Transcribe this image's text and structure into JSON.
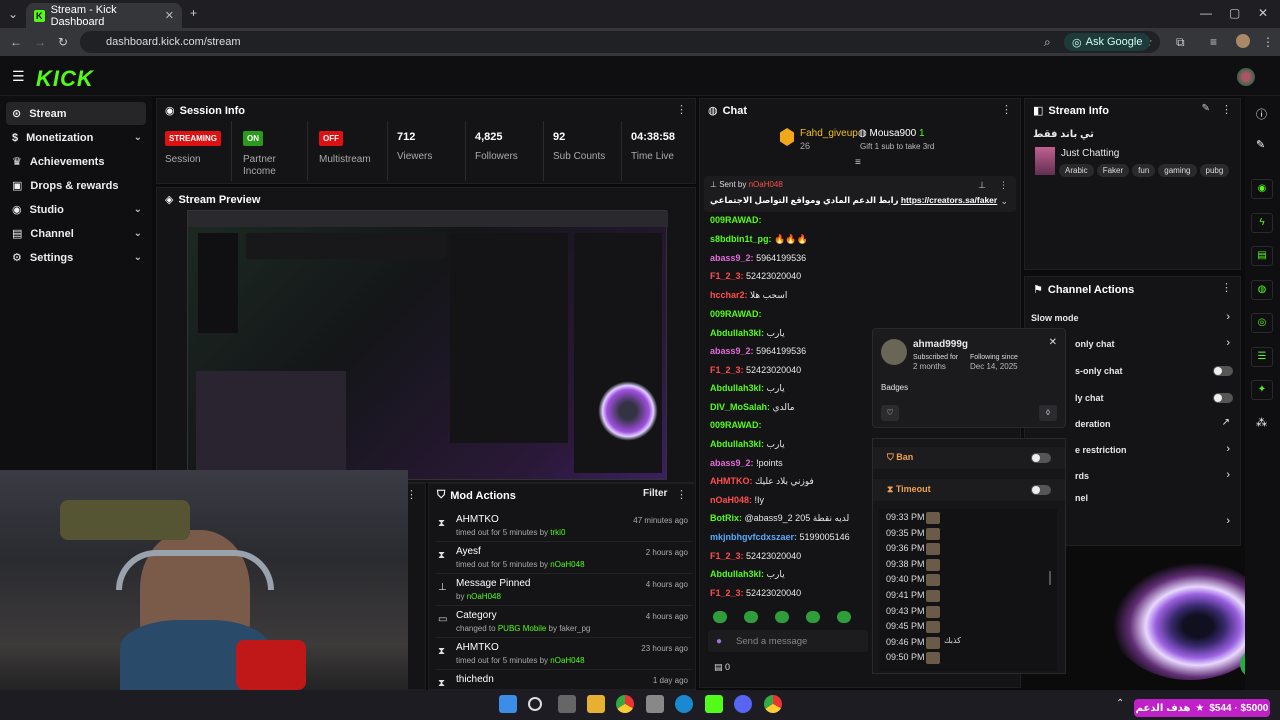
{
  "browser": {
    "tab_title": "Stream - Kick Dashboard",
    "url": "dashboard.kick.com/stream",
    "ask_google": "Ask Google"
  },
  "app": {
    "logo": "KICK"
  },
  "sidebar": {
    "items": [
      {
        "label": "Stream",
        "active": true
      },
      {
        "label": "Monetization",
        "chevron": true
      },
      {
        "label": "Achievements"
      },
      {
        "label": "Drops & rewards"
      },
      {
        "label": "Studio",
        "chevron": true
      },
      {
        "label": "Channel",
        "chevron": true
      },
      {
        "label": "Settings",
        "chevron": true
      }
    ]
  },
  "session_info": {
    "title": "Session Info",
    "session_badge": "STREAMING",
    "session_label": "Session",
    "partner_badge": "ON",
    "partner_label": "Partner Income",
    "multistream_badge": "OFF",
    "multistream_label": "Multistream",
    "viewers_val": "712",
    "viewers_label": "Viewers",
    "followers_val": "4,825",
    "followers_label": "Followers",
    "subs_val": "92",
    "subs_label": "Sub Counts",
    "time_val": "04:38:58",
    "time_label": "Time Live"
  },
  "preview": {
    "title": "Stream Preview"
  },
  "mod_actions": {
    "title": "Mod Actions",
    "filter": "Filter",
    "rows": [
      {
        "title": "AHMTKO",
        "sub_prefix": "timed out for 5 minutes by",
        "sub_user": "trki0",
        "time": "47 minutes ago",
        "icon": "⧗"
      },
      {
        "title": "Ayesf",
        "sub_prefix": "timed out for 5 minutes by",
        "sub_user": "nOaH048",
        "time": "2 hours ago",
        "icon": "⧗"
      },
      {
        "title": "Message Pinned",
        "sub_prefix": "by",
        "sub_user": "nOaH048",
        "time": "4 hours ago",
        "icon": "📌"
      },
      {
        "title": "Category",
        "sub_prefix": "changed to",
        "sub_user": "PUBG Mobile",
        "sub_extra": "by faker_pg",
        "time": "4 hours ago",
        "icon": "▭"
      },
      {
        "title": "AHMTKO",
        "sub_prefix": "timed out for 5 minutes by",
        "sub_user": "nOaH048",
        "time": "23 hours ago",
        "icon": "⧗"
      },
      {
        "title": "thichedn",
        "sub_prefix": "",
        "sub_user": "",
        "time": "1 day ago",
        "icon": "⧗"
      }
    ]
  },
  "chat": {
    "title": "Chat",
    "top_gifter": "Fahd_giveup",
    "top_gifter_count": "26",
    "gift_user": "Mousa900",
    "gift_count": "1",
    "gift_text": "Gift 1 sub to take 3rd",
    "pinned_sender_label": "Sent by",
    "pinned_sender": "nOaH048",
    "pinned_text": "رابط الدعم المادي ومواقع التواصل الاجتماعي ",
    "pinned_link": "https://creators.sa/faker",
    "messages": [
      {
        "user": "009RAWAD:",
        "text": "",
        "color": "#53fc18"
      },
      {
        "user": "s8bdbin1t_pg:",
        "text": "🔥🔥🔥",
        "color": "#53fc18"
      },
      {
        "user": "abass9_2:",
        "text": "5964199536",
        "color": "#e26bd8"
      },
      {
        "user": "F1_2_3:",
        "text": "52423020040",
        "color": "#ff4d4d"
      },
      {
        "user": "hcchar2:",
        "text": "اسحب هلا",
        "color": "#ff4d4d"
      },
      {
        "user": "009RAWAD:",
        "text": "",
        "color": "#53fc18"
      },
      {
        "user": "Abdullah3kl:",
        "text": "يارب",
        "color": "#53fc18"
      },
      {
        "user": "abass9_2:",
        "text": "5964199536",
        "color": "#e26bd8"
      },
      {
        "user": "F1_2_3:",
        "text": "52423020040",
        "color": "#ff4d4d"
      },
      {
        "user": "Abdullah3kl:",
        "text": "يارب",
        "color": "#53fc18"
      },
      {
        "user": "DIV_MoSalah:",
        "text": "مالدي",
        "color": "#53fc18"
      },
      {
        "user": "009RAWAD:",
        "text": "",
        "color": "#53fc18"
      },
      {
        "user": "Abdullah3kl:",
        "text": "يارب",
        "color": "#53fc18"
      },
      {
        "user": "abass9_2:",
        "text": "!points",
        "color": "#e26bd8"
      },
      {
        "user": "AHMTKO:",
        "text": "فوزني بلاد عليك",
        "color": "#ff4d4d"
      },
      {
        "user": "nOaH048:",
        "text": "!Iy",
        "color": "#ff4d4d"
      },
      {
        "user": "BotRix:",
        "text": "@abass9_2 205 لديه نقطة",
        "color": "#53fc18"
      },
      {
        "user": "mkjnbhgvfcdxszaer:",
        "text": "5199005146",
        "color": "#5aa9ff"
      },
      {
        "user": "F1_2_3:",
        "text": "52423020040",
        "color": "#ff4d4d"
      },
      {
        "user": "Abdullah3kl:",
        "text": "يارب",
        "color": "#53fc18"
      },
      {
        "user": "F1_2_3:",
        "text": "52423020040",
        "color": "#ff4d4d"
      }
    ],
    "input_placeholder": "Send a message",
    "points": "0"
  },
  "stream_info": {
    "title": "Stream Info",
    "stream_title": "تي باند فقط",
    "category": "Just Chatting",
    "tags": [
      "Arabic",
      "Faker",
      "fun",
      "gaming",
      "pubg"
    ]
  },
  "channel_actions": {
    "title": "Channel Actions",
    "items": [
      {
        "label": "Slow mode"
      },
      {
        "label": "only chat"
      },
      {
        "label": "s-only chat"
      },
      {
        "label": "ly chat"
      },
      {
        "label": "deration"
      },
      {
        "label": "e restriction"
      },
      {
        "label": "rds"
      },
      {
        "label": "nel"
      }
    ]
  },
  "user_card": {
    "username": "ahmad999g",
    "subscribed_label": "Subscribed for",
    "subscribed_val": "2 months",
    "following_label": "Following since",
    "following_val": "Dec 14, 2025",
    "badges_label": "Badges",
    "ban_label": "Ban",
    "timeout_label": "Timeout",
    "times": [
      "09:33 PM",
      "09:35 PM",
      "09:36 PM",
      "09:38 PM",
      "09:40 PM",
      "09:41 PM",
      "09:43 PM",
      "09:45 PM",
      "09:46 PM",
      "09:50 PM"
    ],
    "last_msg": "كذبك"
  },
  "overlay": {
    "donate_text": "هدف الدعم",
    "donate_amount": "$544 · $5000"
  },
  "colors": {
    "kick_green": "#53fc18",
    "panel": "#141416",
    "bg": "#0b0b0c"
  }
}
